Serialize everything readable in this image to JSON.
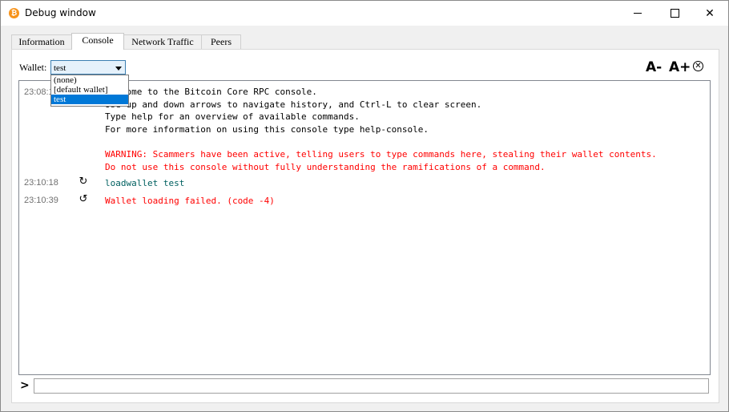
{
  "window": {
    "title": "Debug window",
    "app_icon": "bitcoin-icon",
    "controls": {
      "minimize_icon": "minimize-icon",
      "maximize_icon": "maximize-icon",
      "close_glyph": "✕"
    }
  },
  "tabs": [
    {
      "label": "Information",
      "active": false
    },
    {
      "label": "Console",
      "active": true
    },
    {
      "label": "Network Traffic",
      "active": false
    },
    {
      "label": "Peers",
      "active": false
    }
  ],
  "wallet": {
    "label": "Wallet:",
    "selected": "test",
    "options": [
      "(none)",
      "[default wallet]",
      "test"
    ]
  },
  "font_controls": {
    "decrease": "A-",
    "increase": "A+",
    "clear_glyph": "✕"
  },
  "console": {
    "entries": [
      {
        "timestamp": "23:08:1",
        "lines": [
          "Welcome to the Bitcoin Core RPC console.",
          "Use up and down arrows to navigate history, and Ctrl-L to clear screen.",
          "Type help for an overview of available commands.",
          "For more information on using this console type help-console."
        ],
        "warning": [
          "WARNING: Scammers have been active, telling users to type commands here, stealing their wallet contents.",
          "Do not use this console without fully understanding the ramifications of a command."
        ]
      },
      {
        "timestamp": "23:10:18",
        "icon": "command-input-icon",
        "text": "loadwallet test"
      },
      {
        "timestamp": "23:10:39",
        "icon": "command-reply-icon",
        "text": "Wallet loading failed. (code -4)"
      }
    ]
  },
  "input": {
    "prompt_glyph": ">",
    "value": ""
  },
  "colors": {
    "command": "#006060",
    "warning": "#ff0000",
    "selection": "#0078d7",
    "bitcoin_orange": "#f7931a"
  }
}
